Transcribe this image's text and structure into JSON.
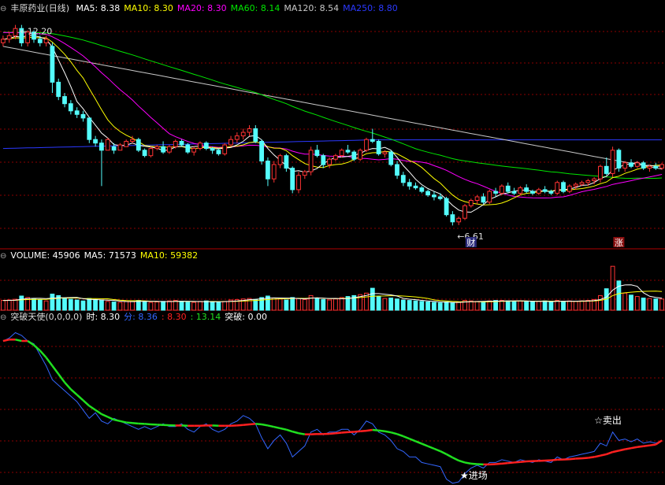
{
  "stock": {
    "name": "丰原药业",
    "period": "日线"
  },
  "colors": {
    "up": "#ff3333",
    "down": "#54fcfc",
    "ma5": "#ffffff",
    "ma10": "#ffff00",
    "ma20": "#ff00ff",
    "ma60": "#00e600",
    "ma120": "#c8c8c8",
    "ma250": "#2b39ff",
    "grid": "#8b0000",
    "divider": "#b00000",
    "fen_line": "#3366ff",
    "shi_up": "#ff2020",
    "shi_down": "#20e020"
  },
  "header_main": [
    {
      "label": "MA5:",
      "value": "8.38",
      "color": "#ffffff"
    },
    {
      "label": "MA10:",
      "value": "8.30",
      "color": "#ffff00"
    },
    {
      "label": "MA20:",
      "value": "8.30",
      "color": "#ff00ff"
    },
    {
      "label": "MA60:",
      "value": "8.14",
      "color": "#00e600"
    },
    {
      "label": "MA120:",
      "value": "8.54",
      "color": "#c8c8c8"
    },
    {
      "label": "MA250:",
      "value": "8.80",
      "color": "#2b39ff"
    }
  ],
  "header_volume": [
    {
      "label": "VOLUME:",
      "value": "45906",
      "color": "#ffffff"
    },
    {
      "label": "MA5:",
      "value": "71573",
      "color": "#ffffff"
    },
    {
      "label": "MA10:",
      "value": "59382",
      "color": "#ffff00"
    }
  ],
  "header_indicator": {
    "name": "突破天使(0,0,0,0)",
    "items": [
      {
        "label": "时:",
        "value": "8.30",
        "color": "#ffffff"
      },
      {
        "label": "分:",
        "value": "8.36",
        "color": "#3366ff"
      },
      {
        "label": ":",
        "value": "8.30",
        "color": "#ff2020"
      },
      {
        "label": ":",
        "value": "13.14",
        "color": "#20e020"
      },
      {
        "label": "突破:",
        "value": "0.00",
        "color": "#ffffff"
      }
    ]
  },
  "annotations": {
    "high": "12.20",
    "low": "6.61",
    "buy": "★进场",
    "sell": "☆卖出",
    "tag_cai": "财",
    "tag_zhang": "涨"
  },
  "chart_data": [
    {
      "type": "candlestick",
      "title": "丰原药业(日线)",
      "ylim": [
        6.3,
        12.5
      ],
      "candles": [
        [
          11.7,
          11.9,
          11.6,
          11.8
        ],
        [
          11.8,
          12.0,
          11.7,
          11.9
        ],
        [
          11.9,
          12.2,
          11.8,
          12.1
        ],
        [
          12.1,
          12.2,
          11.6,
          11.7
        ],
        [
          11.7,
          12.05,
          11.6,
          12.0
        ],
        [
          12.0,
          12.05,
          11.7,
          11.8
        ],
        [
          11.8,
          11.9,
          11.6,
          11.7
        ],
        [
          11.7,
          11.9,
          11.6,
          11.8
        ],
        [
          11.6,
          11.7,
          10.3,
          10.6
        ],
        [
          10.6,
          10.7,
          10.1,
          10.2
        ],
        [
          10.2,
          10.3,
          9.9,
          10.0
        ],
        [
          10.0,
          10.1,
          9.7,
          9.8
        ],
        [
          9.8,
          9.9,
          9.6,
          9.7
        ],
        [
          9.7,
          9.8,
          9.5,
          9.6
        ],
        [
          9.6,
          9.6,
          8.9,
          9.0
        ],
        [
          9.0,
          9.1,
          8.8,
          8.9
        ],
        [
          8.9,
          9.0,
          7.7,
          8.7
        ],
        [
          8.7,
          9.05,
          8.7,
          9.0
        ],
        [
          8.8,
          8.9,
          8.6,
          8.7
        ],
        [
          8.7,
          8.9,
          8.7,
          8.85
        ],
        [
          8.8,
          9.0,
          8.8,
          8.95
        ],
        [
          8.95,
          9.1,
          8.9,
          9.0
        ],
        [
          9.0,
          9.05,
          8.65,
          8.7
        ],
        [
          8.7,
          8.75,
          8.5,
          8.55
        ],
        [
          8.55,
          8.8,
          8.5,
          8.75
        ],
        [
          8.75,
          8.85,
          8.7,
          8.8
        ],
        [
          8.8,
          8.95,
          8.6,
          8.65
        ],
        [
          8.65,
          8.85,
          8.6,
          8.8
        ],
        [
          8.8,
          9.0,
          8.75,
          8.95
        ],
        [
          8.95,
          9.0,
          8.8,
          8.85
        ],
        [
          8.85,
          8.9,
          8.6,
          8.65
        ],
        [
          8.65,
          8.8,
          8.55,
          8.75
        ],
        [
          8.75,
          8.95,
          8.7,
          8.9
        ],
        [
          8.9,
          8.95,
          8.7,
          8.75
        ],
        [
          8.75,
          8.8,
          8.6,
          8.7
        ],
        [
          8.7,
          8.75,
          8.55,
          8.6
        ],
        [
          8.6,
          8.9,
          8.55,
          8.85
        ],
        [
          8.85,
          9.1,
          8.8,
          9.0
        ],
        [
          9.0,
          9.2,
          8.9,
          9.1
        ],
        [
          9.1,
          9.3,
          9.0,
          9.2
        ],
        [
          9.2,
          9.4,
          9.1,
          9.3
        ],
        [
          9.3,
          9.4,
          8.9,
          8.95
        ],
        [
          8.95,
          9.0,
          8.3,
          8.4
        ],
        [
          8.4,
          8.5,
          7.7,
          7.9
        ],
        [
          7.9,
          8.4,
          7.8,
          8.3
        ],
        [
          8.3,
          8.6,
          8.2,
          8.55
        ],
        [
          8.55,
          8.6,
          8.1,
          8.2
        ],
        [
          8.2,
          8.25,
          7.5,
          7.6
        ],
        [
          7.6,
          8.1,
          7.5,
          8.0
        ],
        [
          8.0,
          8.15,
          7.9,
          8.1
        ],
        [
          8.1,
          8.8,
          8.0,
          8.7
        ],
        [
          8.7,
          8.85,
          8.5,
          8.55
        ],
        [
          8.55,
          8.6,
          8.2,
          8.3
        ],
        [
          8.3,
          8.5,
          8.2,
          8.45
        ],
        [
          8.45,
          8.6,
          8.4,
          8.55
        ],
        [
          8.55,
          8.75,
          8.5,
          8.7
        ],
        [
          8.7,
          8.85,
          8.6,
          8.65
        ],
        [
          8.65,
          8.7,
          8.4,
          8.45
        ],
        [
          8.45,
          8.75,
          8.4,
          8.7
        ],
        [
          8.7,
          9.05,
          8.65,
          9.0
        ],
        [
          9.0,
          9.3,
          8.9,
          8.95
        ],
        [
          8.95,
          9.0,
          8.55,
          8.6
        ],
        [
          8.6,
          8.7,
          8.5,
          8.65
        ],
        [
          8.65,
          8.7,
          8.25,
          8.3
        ],
        [
          8.3,
          8.4,
          7.9,
          8.0
        ],
        [
          8.0,
          8.1,
          7.7,
          7.8
        ],
        [
          7.8,
          7.9,
          7.6,
          7.7
        ],
        [
          7.7,
          7.8,
          7.6,
          7.65
        ],
        [
          7.65,
          7.7,
          7.5,
          7.55
        ],
        [
          7.55,
          7.6,
          7.4,
          7.45
        ],
        [
          7.45,
          7.55,
          7.3,
          7.4
        ],
        [
          7.4,
          7.5,
          7.3,
          7.35
        ],
        [
          7.35,
          7.4,
          6.85,
          6.9
        ],
        [
          6.9,
          7.0,
          6.6,
          6.7
        ],
        [
          6.7,
          6.85,
          6.61,
          6.8
        ],
        [
          6.8,
          7.2,
          6.75,
          7.15
        ],
        [
          7.15,
          7.35,
          7.1,
          7.3
        ],
        [
          7.3,
          7.45,
          7.2,
          7.4
        ],
        [
          7.4,
          7.5,
          7.2,
          7.25
        ],
        [
          7.25,
          7.6,
          7.2,
          7.55
        ],
        [
          7.55,
          7.65,
          7.4,
          7.5
        ],
        [
          7.5,
          7.75,
          7.45,
          7.7
        ],
        [
          7.7,
          7.8,
          7.5,
          7.55
        ],
        [
          7.55,
          7.65,
          7.45,
          7.5
        ],
        [
          7.5,
          7.7,
          7.45,
          7.65
        ],
        [
          7.65,
          7.75,
          7.5,
          7.55
        ],
        [
          7.55,
          7.6,
          7.45,
          7.5
        ],
        [
          7.5,
          7.65,
          7.45,
          7.6
        ],
        [
          7.6,
          7.7,
          7.5,
          7.55
        ],
        [
          7.55,
          7.6,
          7.45,
          7.5
        ],
        [
          7.5,
          7.85,
          7.45,
          7.8
        ],
        [
          7.8,
          7.85,
          7.5,
          7.55
        ],
        [
          7.55,
          7.75,
          7.5,
          7.7
        ],
        [
          7.7,
          7.8,
          7.6,
          7.75
        ],
        [
          7.75,
          7.85,
          7.7,
          7.8
        ],
        [
          7.8,
          7.9,
          7.7,
          7.85
        ],
        [
          7.85,
          7.95,
          7.75,
          7.9
        ],
        [
          7.9,
          8.3,
          7.8,
          8.25
        ],
        [
          8.25,
          8.5,
          8.0,
          8.05
        ],
        [
          8.05,
          8.8,
          7.95,
          8.7
        ],
        [
          8.7,
          8.75,
          8.1,
          8.2
        ],
        [
          8.2,
          8.4,
          8.1,
          8.35
        ],
        [
          8.35,
          8.45,
          8.2,
          8.25
        ],
        [
          8.25,
          8.4,
          8.2,
          8.35
        ],
        [
          8.35,
          8.4,
          8.15,
          8.2
        ],
        [
          8.2,
          8.3,
          8.1,
          8.25
        ],
        [
          8.25,
          8.35,
          8.15,
          8.2
        ],
        [
          8.2,
          8.35,
          8.15,
          8.3
        ]
      ],
      "markers": {
        "high": {
          "index": 2,
          "value": 12.2
        },
        "low": {
          "index": 74,
          "value": 6.61
        }
      }
    },
    {
      "type": "bar",
      "title": "VOLUME",
      "ylim": [
        0,
        200000
      ],
      "values": [
        40000,
        42000,
        45000,
        58000,
        52000,
        46000,
        43000,
        38000,
        66000,
        60000,
        50000,
        45000,
        42000,
        38000,
        48000,
        44000,
        40000,
        36000,
        34000,
        32000,
        36000,
        38000,
        40000,
        36000,
        32000,
        34000,
        36000,
        38000,
        40000,
        36000,
        33000,
        32000,
        36000,
        38000,
        34000,
        32000,
        36000,
        42000,
        44000,
        46000,
        48000,
        44000,
        52000,
        58000,
        50000,
        46000,
        42000,
        52000,
        48000,
        44000,
        60000,
        50000,
        44000,
        42000,
        46000,
        52000,
        56000,
        60000,
        64000,
        70000,
        90000,
        56000,
        48000,
        50000,
        46000,
        42000,
        40000,
        38000,
        36000,
        34000,
        32000,
        30000,
        34000,
        30000,
        34000,
        40000,
        38000,
        36000,
        34000,
        38000,
        40000,
        40000,
        38000,
        36000,
        38000,
        36000,
        34000,
        36000,
        38000,
        34000,
        40000,
        36000,
        38000,
        36000,
        38000,
        40000,
        44000,
        60000,
        88000,
        180000,
        120000,
        70000,
        62000,
        56000,
        50000,
        48000,
        46000,
        45906
      ]
    },
    {
      "type": "line",
      "title": "突破天使(0,0,0,0)",
      "ylim": [
        6.8,
        12.5
      ],
      "series": [
        {
          "name": "分",
          "values": [
            11.9,
            12.0,
            12.2,
            12.1,
            11.9,
            11.8,
            11.4,
            11.0,
            10.5,
            10.3,
            10.1,
            9.9,
            9.7,
            9.4,
            9.1,
            9.3,
            9.0,
            8.9,
            9.1,
            9.0,
            8.9,
            8.8,
            8.7,
            8.8,
            8.7,
            8.8,
            8.9,
            8.8,
            8.8,
            8.9,
            8.7,
            8.6,
            8.8,
            8.9,
            8.7,
            8.6,
            8.7,
            8.9,
            9.0,
            9.2,
            9.1,
            8.9,
            8.4,
            8.0,
            8.3,
            8.5,
            8.2,
            7.7,
            7.9,
            8.1,
            8.6,
            8.7,
            8.5,
            8.6,
            8.6,
            8.7,
            8.7,
            8.5,
            8.7,
            9.0,
            8.9,
            8.6,
            8.5,
            8.3,
            8.0,
            7.9,
            7.7,
            7.7,
            7.5,
            7.45,
            7.4,
            7.35,
            6.9,
            6.75,
            6.8,
            7.1,
            7.3,
            7.4,
            7.3,
            7.5,
            7.5,
            7.6,
            7.55,
            7.5,
            7.6,
            7.55,
            7.5,
            7.6,
            7.55,
            7.5,
            7.7,
            7.6,
            7.7,
            7.75,
            7.8,
            7.85,
            7.9,
            8.2,
            8.1,
            8.6,
            8.3,
            8.35,
            8.25,
            8.35,
            8.2,
            8.25,
            8.2,
            8.3
          ]
        },
        {
          "name": "时",
          "values": [
            11.9,
            11.95,
            11.95,
            11.9,
            11.9,
            11.75,
            11.55,
            11.3,
            11.0,
            10.7,
            10.4,
            10.15,
            9.95,
            9.75,
            9.55,
            9.4,
            9.25,
            9.15,
            9.05,
            9.0,
            8.95,
            8.93,
            8.91,
            8.9,
            8.88,
            8.87,
            8.86,
            8.85,
            8.84,
            8.84,
            8.83,
            8.83,
            8.83,
            8.84,
            8.84,
            8.83,
            8.83,
            8.83,
            8.84,
            8.86,
            8.88,
            8.9,
            8.88,
            8.84,
            8.79,
            8.74,
            8.69,
            8.62,
            8.56,
            8.52,
            8.52,
            8.53,
            8.53,
            8.54,
            8.56,
            8.58,
            8.6,
            8.61,
            8.63,
            8.65,
            8.68,
            8.66,
            8.63,
            8.59,
            8.53,
            8.45,
            8.36,
            8.27,
            8.18,
            8.09,
            8.0,
            7.91,
            7.8,
            7.68,
            7.57,
            7.5,
            7.46,
            7.44,
            7.43,
            7.43,
            7.44,
            7.46,
            7.48,
            7.5,
            7.52,
            7.54,
            7.55,
            7.56,
            7.57,
            7.58,
            7.6,
            7.61,
            7.62,
            7.64,
            7.65,
            7.67,
            7.7,
            7.75,
            7.8,
            7.88,
            7.93,
            7.98,
            8.02,
            8.06,
            8.09,
            8.12,
            8.15,
            8.3
          ]
        }
      ],
      "signals": [
        {
          "label": "★进场",
          "index": 75
        },
        {
          "label": "☆卖出",
          "index": 96
        }
      ]
    }
  ]
}
